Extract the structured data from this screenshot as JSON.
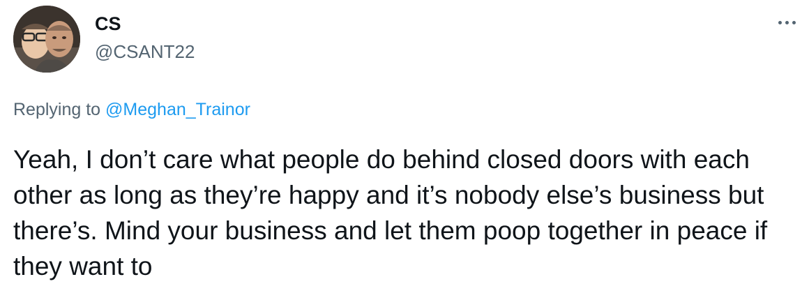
{
  "author": {
    "display_name": "CS",
    "handle": "@CSANT22"
  },
  "reply": {
    "prefix": "Replying to ",
    "mention": "@Meghan_Trainor"
  },
  "tweet": {
    "text": "Yeah, I don’t care what people do behind closed doors with each other as long as they’re happy and it’s nobody else’s business but there’s. Mind your business and let them poop together in peace if they want to"
  },
  "icons": {
    "more": "more-horizontal-icon"
  },
  "colors": {
    "text_primary": "#0f1419",
    "text_secondary": "#536471",
    "link": "#1d9bf0",
    "background": "#ffffff"
  }
}
